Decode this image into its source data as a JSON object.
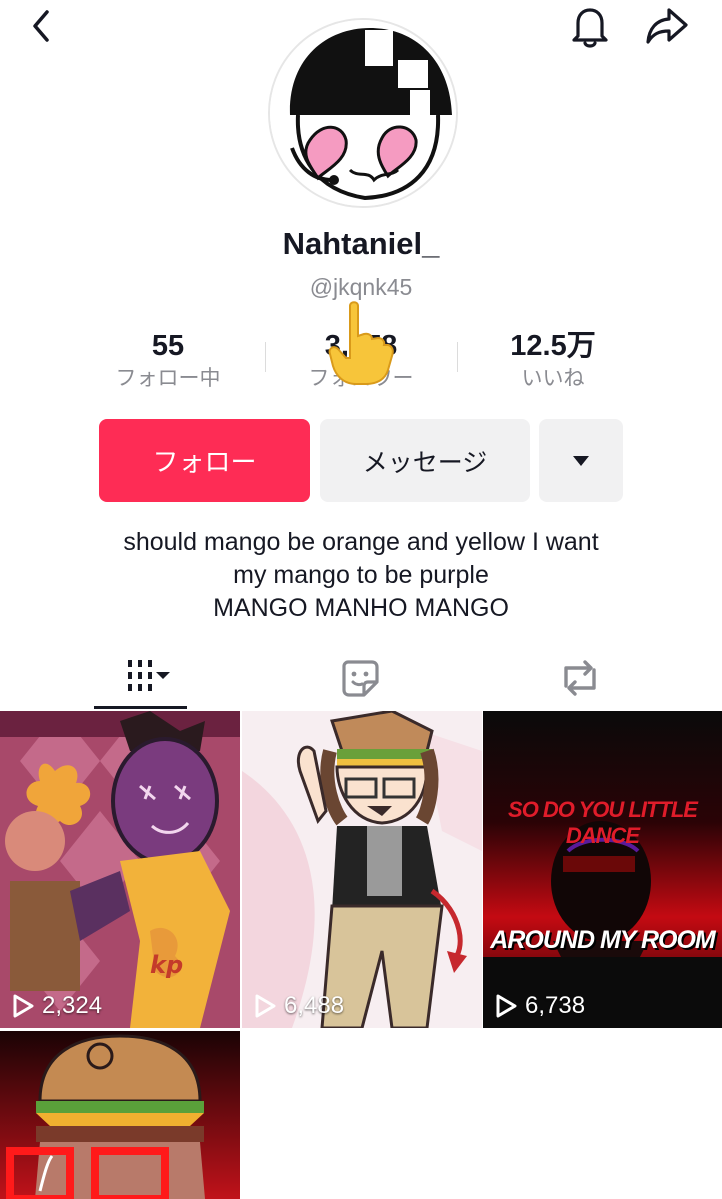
{
  "profile": {
    "display_name": "Nahtaniel_",
    "handle": "@jkqnk45"
  },
  "stats": [
    {
      "value": "55",
      "label": "フォロー中"
    },
    {
      "value": "3,678",
      "label": "フォロワー"
    },
    {
      "value": "12.5万",
      "label": "いいね"
    }
  ],
  "actions": {
    "follow_label": "フォロー",
    "message_label": "メッセージ"
  },
  "bio": {
    "line1": "should mango be orange and yellow I want",
    "line2": "my mango to be purple",
    "line3": "MANGO MANHO MANGO"
  },
  "tabs": [
    {
      "icon": "grid-videos-icon",
      "selected": true
    },
    {
      "icon": "favorites-icon",
      "selected": false
    },
    {
      "icon": "reposts-icon",
      "selected": false
    }
  ],
  "videos": [
    {
      "views": "2,324"
    },
    {
      "views": "6,488"
    },
    {
      "views": "6,738",
      "caption_top": "SO DO YOU LITTLE DANCE",
      "caption_bottom": "AROUND MY ROOM"
    },
    {
      "views": ""
    }
  ],
  "colors": {
    "accent": "#fe2c55",
    "secondary_button": "#f1f1f2",
    "muted_text": "#8a8b91"
  }
}
